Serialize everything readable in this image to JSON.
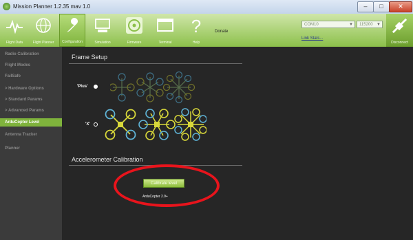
{
  "window": {
    "title": "Mission Planner 1.2.35 mav 1.0",
    "min": "–",
    "max": "□",
    "close": "✕"
  },
  "toolbar": {
    "buttons": [
      {
        "label": "Flight Data",
        "icon": "pulse-icon"
      },
      {
        "label": "Flight Planner",
        "icon": "globe-icon"
      },
      {
        "label": "Configuration",
        "icon": "wrench-icon"
      },
      {
        "label": "Simulation",
        "icon": "computer-icon"
      },
      {
        "label": "Firmware",
        "icon": "disc-icon"
      },
      {
        "label": "Terminal",
        "icon": "terminal-icon"
      },
      {
        "label": "Help",
        "icon": "question-icon"
      }
    ],
    "donate": "Donate",
    "com_port": "COM10",
    "baud_rate": "115200",
    "link_stats": "Link Stats...",
    "disconnect": "Disconnect"
  },
  "sidebar": {
    "items": [
      {
        "label": "Radio Calibration",
        "active": false
      },
      {
        "label": "Flight Modes",
        "active": false
      },
      {
        "label": "FailSafe",
        "active": false
      },
      {
        "label": "> Hardware Options",
        "active": false
      },
      {
        "label": "> Standard Params",
        "active": false
      },
      {
        "label": "> Advanced Params",
        "active": false
      },
      {
        "label": "ArduCopter Level",
        "active": true
      },
      {
        "label": "Antenna Tracker",
        "active": false
      },
      {
        "label": "Planner",
        "active": false
      }
    ]
  },
  "main": {
    "frame_setup_title": "Frame Setup",
    "plus_label": "'Plus'",
    "x_label": "'X'",
    "accel_title": "Accelerometer Calibration",
    "calibrate_button": "Calibrate level",
    "version_note": "ArduCopter 2.9+"
  },
  "colors": {
    "accent": "#8cc04a",
    "highlight_ring": "#e8141c",
    "prop_blue": "#5fb3d6",
    "prop_yellow": "#d8d83a"
  }
}
